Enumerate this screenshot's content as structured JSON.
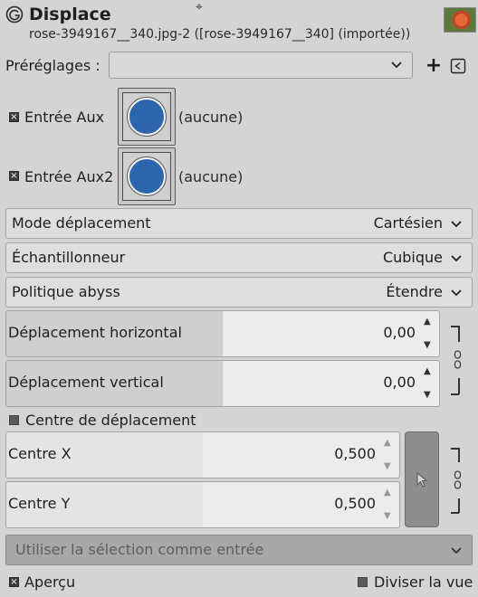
{
  "header": {
    "title": "Displace",
    "subtitle": "rose-3949167__340.jpg-2 ([rose-3949167__340] (importée))"
  },
  "presets": {
    "label": "Préréglages :",
    "value": ""
  },
  "aux_inputs": [
    {
      "label": "Entrée Aux",
      "value": "(aucune)",
      "checked": true
    },
    {
      "label": "Entrée Aux2",
      "value": "(aucune)",
      "checked": true
    }
  ],
  "combos": {
    "mode": {
      "label": "Mode déplacement",
      "value": "Cartésien"
    },
    "sampler": {
      "label": "Échantillonneur",
      "value": "Cubique"
    },
    "abyss": {
      "label": "Politique abyss",
      "value": "Étendre"
    }
  },
  "spins": {
    "disp_h": {
      "label": "Déplacement horizontal",
      "value": "0,00",
      "fill": 0.5
    },
    "disp_v": {
      "label": "Déplacement vertical",
      "value": "0,00",
      "fill": 0.5
    },
    "center_x": {
      "label": "Centre X",
      "value": "0,500",
      "fill": 0.5
    },
    "center_y": {
      "label": "Centre Y",
      "value": "0,500",
      "fill": 0.5
    }
  },
  "center_toggle": {
    "label": "Centre de déplacement",
    "checked": false
  },
  "use_selection": {
    "label": "Utiliser la sélection comme entrée"
  },
  "footer": {
    "preview": {
      "label": "Aperçu",
      "checked": true
    },
    "split": {
      "label": "Diviser la vue",
      "checked": false
    }
  },
  "colors": {
    "background": "#d4d4d4",
    "aux_dot": "#2e66ad"
  }
}
